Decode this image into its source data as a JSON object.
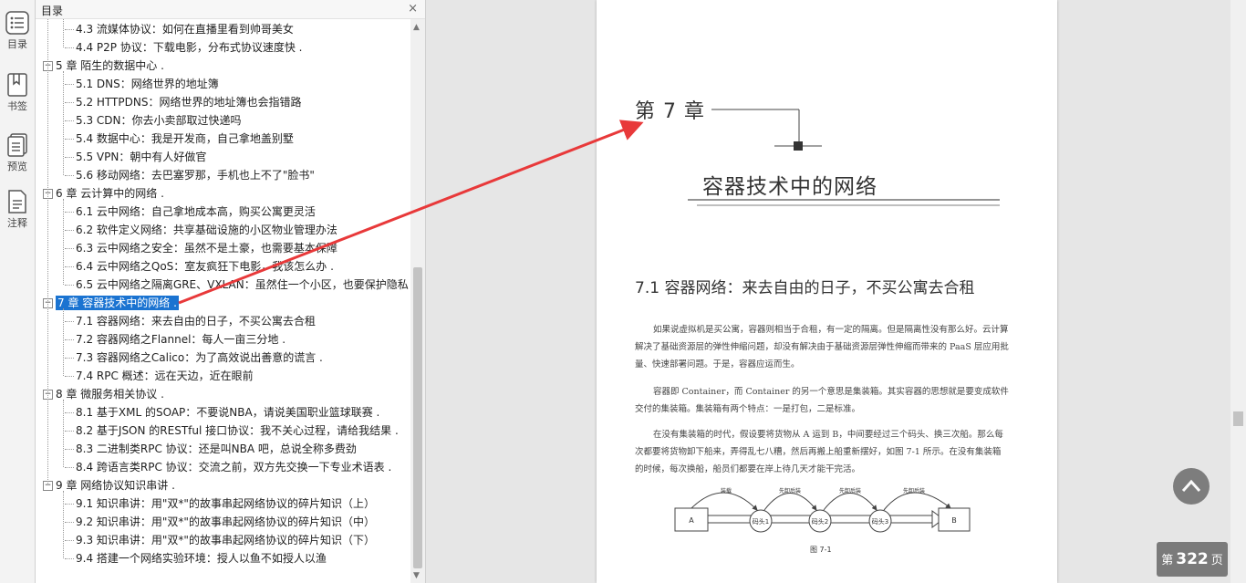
{
  "rail": [
    {
      "label": "目录",
      "icon": "toc-icon"
    },
    {
      "label": "书签",
      "icon": "bookmark-icon"
    },
    {
      "label": "预览",
      "icon": "preview-icon"
    },
    {
      "label": "注释",
      "icon": "annotation-icon"
    }
  ],
  "panel": {
    "title": "目录",
    "close": "×"
  },
  "outline": [
    {
      "level": 2,
      "text": "4.3 流媒体协议：如何在直播里看到帅哥美女"
    },
    {
      "level": 2,
      "text": "4.4 P2P 协议：下载电影，分布式协议速度快 ."
    },
    {
      "level": 1,
      "text": "5 章 陌生的数据中心 ."
    },
    {
      "level": 2,
      "text": "5.1 DNS：网络世界的地址簿"
    },
    {
      "level": 2,
      "text": "5.2 HTTPDNS：网络世界的地址簿也会指错路"
    },
    {
      "level": 2,
      "text": "5.3 CDN：你去小卖部取过快递吗"
    },
    {
      "level": 2,
      "text": "5.4 数据中心：我是开发商，自己拿地盖别墅"
    },
    {
      "level": 2,
      "text": "5.5 VPN：朝中有人好做官"
    },
    {
      "level": 2,
      "text": "5.6 移动网络：去巴塞罗那，手机也上不了\"脸书\""
    },
    {
      "level": 1,
      "text": "6 章 云计算中的网络 ."
    },
    {
      "level": 2,
      "text": "6.1 云中网络：自己拿地成本高，购买公寓更灵活"
    },
    {
      "level": 2,
      "text": "6.2 软件定义网络：共享基础设施的小区物业管理办法"
    },
    {
      "level": 2,
      "text": "6.3 云中网络之安全：虽然不是土豪，也需要基本保障"
    },
    {
      "level": 2,
      "text": "6.4 云中网络之QoS：室友疯狂下电影，我该怎么办 ."
    },
    {
      "level": 2,
      "text": "6.5 云中网络之隔离GRE、VXLAN：虽然住一个小区，也要保护隐私"
    },
    {
      "level": 1,
      "text": "7 章 容器技术中的网络 .",
      "selected": true
    },
    {
      "level": 2,
      "text": "7.1 容器网络：来去自由的日子，不买公寓去合租"
    },
    {
      "level": 2,
      "text": "7.2 容器网络之Flannel：每人一亩三分地 ."
    },
    {
      "level": 2,
      "text": "7.3 容器网络之Calico：为了高效说出善意的谎言 ."
    },
    {
      "level": 2,
      "text": "7.4 RPC 概述：远在天边，近在眼前"
    },
    {
      "level": 1,
      "text": "8 章 微服务相关协议 ."
    },
    {
      "level": 2,
      "text": "8.1 基于XML 的SOAP：不要说NBA，请说美国职业篮球联赛 ."
    },
    {
      "level": 2,
      "text": "8.2 基于JSON 的RESTful 接口协议：我不关心过程，请给我结果 ."
    },
    {
      "level": 2,
      "text": "8.3 二进制类RPC 协议：还是叫NBA 吧，总说全称多费劲"
    },
    {
      "level": 2,
      "text": "8.4 跨语言类RPC 协议：交流之前，双方先交换一下专业术语表 ."
    },
    {
      "level": 1,
      "text": "9 章 网络协议知识串讲 ."
    },
    {
      "level": 2,
      "text": "9.1 知识串讲：用\"双*\"的故事串起网络协议的碎片知识（上）"
    },
    {
      "level": 2,
      "text": "9.2 知识串讲：用\"双*\"的故事串起网络协议的碎片知识（中）"
    },
    {
      "level": 2,
      "text": "9.3 知识串讲：用\"双*\"的故事串起网络协议的碎片知识（下）"
    },
    {
      "level": 2,
      "text": "9.4 搭建一个网络实验环境：授人以鱼不如授人以渔"
    }
  ],
  "page": {
    "chapter_number": "第 7 章",
    "chapter_title": "容器技术中的网络",
    "section_title": "7.1   容器网络：来去自由的日子，不买公寓去合租",
    "paragraphs": [
      "如果说虚拟机是买公寓，容器则相当于合租，有一定的隔离。但是隔离性没有那么好。云计算解决了基础资源层的弹性伸缩问题，却没有解决由于基础资源层弹性伸缩而带来的 PaaS 层应用批量、快速部署问题。于是，容器应运而生。",
      "容器即 Container，而 Container 的另一个意思是集装箱。其实容器的思想就是要变成软件交付的集装箱。集装箱有两个特点：一是打包，二是标准。",
      "在没有集装箱的时代，假设要将货物从 A 运到 B，中间要经过三个码头、换三次船。那么每次都要将货物卸下船来，弄得乱七八糟，然后再搬上船重新摆好，如图 7-1 所示。在没有集装箱的时候，每次换船，船员们都要在岸上待几天才能干完活。"
    ],
    "figure": {
      "caption": "图 7-1",
      "nodes": [
        "A",
        "码头1",
        "码头2",
        "码头3",
        "B"
      ],
      "arcs": [
        "装载",
        "先卸后装",
        "先卸后装",
        "先卸后装"
      ]
    }
  },
  "page_indicator": {
    "prefix": "第",
    "number": "322",
    "suffix": "页"
  },
  "colors": {
    "selection": "#1a73d1",
    "arrow": "#e8393a"
  }
}
